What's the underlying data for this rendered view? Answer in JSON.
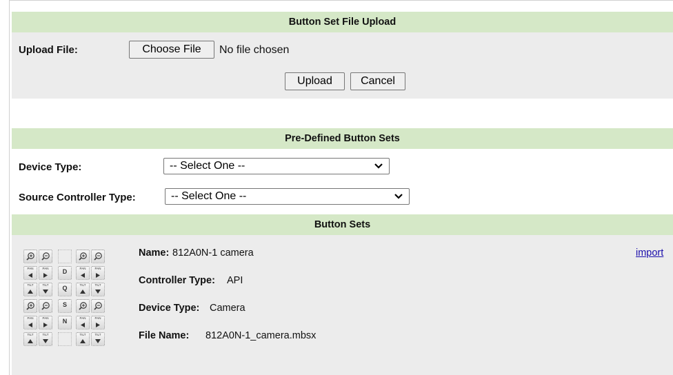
{
  "upload_section": {
    "title": "Button Set File Upload",
    "upload_label": "Upload File:",
    "choose_file_label": "Choose File",
    "no_file_text": "No file chosen",
    "upload_button": "Upload",
    "cancel_button": "Cancel"
  },
  "predefined_section": {
    "title": "Pre-Defined Button Sets",
    "device_type_label": "Device Type:",
    "device_type_value": "-- Select One --",
    "source_controller_label": "Source Controller Type:",
    "source_controller_value": "-- Select One --"
  },
  "button_sets": {
    "title": "Button Sets",
    "items": [
      {
        "name_label": "Name:",
        "name": "812A0N-1 camera",
        "controller_label": "Controller Type:",
        "controller": "API",
        "device_label": "Device Type:",
        "device": "Camera",
        "file_label": "File Name:",
        "file": "812A0N-1_camera.mbsx",
        "import_link": "import",
        "preview_buttons": [
          [
            "zoom-in-icon",
            "zoom-out-icon",
            "",
            "zoom-in-icon",
            "zoom-out-icon"
          ],
          [
            "pan-left-icon",
            "pan-right-icon",
            "D",
            "pan-left-icon",
            "pan-right-icon"
          ],
          [
            "tilt-up-icon",
            "tilt-down-icon",
            "Q",
            "tilt-up-icon",
            "tilt-down-icon"
          ],
          [
            "zoom-in-icon",
            "zoom-out-icon",
            "S",
            "zoom-in-icon",
            "zoom-out-icon"
          ],
          [
            "pan-left-icon",
            "pan-right-icon",
            "N",
            "pan-left-icon",
            "pan-right-icon"
          ],
          [
            "tilt-up-icon",
            "tilt-down-icon",
            "",
            "tilt-up-icon",
            "tilt-down-icon"
          ]
        ],
        "pan_text": "PAN",
        "tilt_text": "TILT"
      }
    ]
  }
}
